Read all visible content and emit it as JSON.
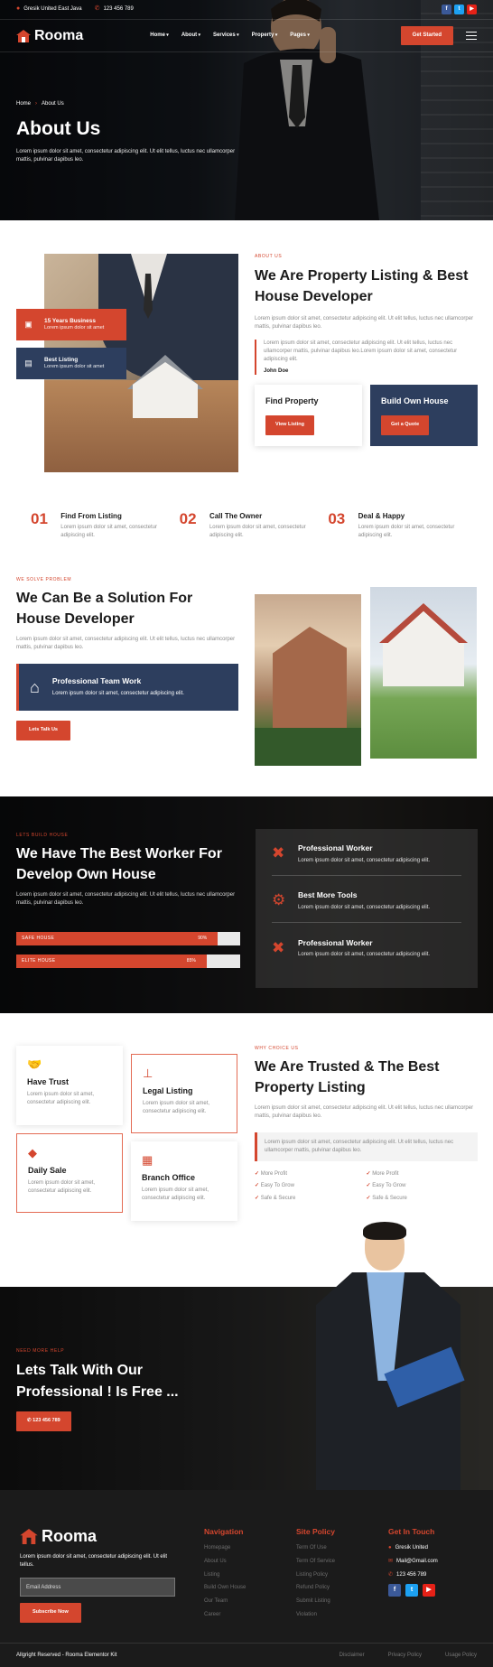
{
  "topbar": {
    "address": "Gresik United East Java",
    "phone": "123 456 789"
  },
  "brand": {
    "name": "Rooma"
  },
  "nav": {
    "items": [
      "Home",
      "About",
      "Services",
      "Property",
      "Pages"
    ],
    "cta": "Get Started"
  },
  "hero": {
    "crumb_home": "Home",
    "crumb_current": "About Us",
    "title": "About Us",
    "desc": "Lorem ipsum dolor sit amet, consectetur adipiscing elit. Ut elit tellus, luctus nec ullamcorper mattis, pulvinar dapibus leo."
  },
  "about": {
    "badges": [
      {
        "title": "15 Years Business",
        "text": "Lorem ipsum dolor sit amet"
      },
      {
        "title": "Best Listing",
        "text": "Lorem ipsum dolor sit amet"
      }
    ],
    "eyebrow": "About Us",
    "title": "We Are Property Listing & Best House Developer",
    "desc": "Lorem ipsum dolor sit amet, consectetur adipiscing elit. Ut elit tellus, luctus nec ullamcorper mattis, pulvinar dapibus leo.",
    "quote": "Lorem ipsum dolor sit amet, consectetur adipiscing elit. Ut elit tellus, luctus nec ullamcorper mattis, pulvinar dapibus leo.Lorem ipsum dolor sit amet, consectetur adipiscing elit.",
    "author": "John Doe",
    "card1": {
      "title": "Find Property",
      "button": "View Listing"
    },
    "card2": {
      "title": "Build Own House",
      "button": "Get a Quote"
    }
  },
  "steps": [
    {
      "num": "01",
      "title": "Find From Listing",
      "text": "Lorem ipsum dolor sit amet, consectetur adipiscing elit."
    },
    {
      "num": "02",
      "title": "Call The Owner",
      "text": "Lorem ipsum dolor sit amet, consectetur adipiscing elit."
    },
    {
      "num": "03",
      "title": "Deal & Happy",
      "text": "Lorem ipsum dolor sit amet, consectetur adipiscing elit."
    }
  ],
  "solution": {
    "eyebrow": "We Solve Problem",
    "title": "We Can Be a Solution For House Developer",
    "desc": "Lorem ipsum dolor sit amet, consectetur adipiscing elit. Ut elit tellus, luctus nec ullamcorper mattis, pulvinar dapibus leo.",
    "team_title": "Professional Team Work",
    "team_text": "Lorem ipsum dolor sit amet, consectetur adipiscing elit.",
    "button": "Lets Talk Us"
  },
  "worker": {
    "eyebrow": "Lets Build House",
    "title": "We Have The Best Worker For Develop Own House",
    "desc": "Lorem ipsum dolor sit amet, consectetur adipiscing elit. Ut elit tellus, luctus nec ullamcorper mattis, pulvinar dapibus leo.",
    "bars": [
      {
        "label": "SAFE HOUSE",
        "pct": "90%",
        "value": 0.9
      },
      {
        "label": "ELITE HOUSE",
        "pct": "85%",
        "value": 0.85
      }
    ],
    "items": [
      {
        "title": "Professional Worker",
        "text": "Lorem ipsum dolor sit amet, consectetur adipiscing elit."
      },
      {
        "title": "Best More Tools",
        "text": "Lorem ipsum dolor sit amet, consectetur adipiscing elit."
      },
      {
        "title": "Professional Worker",
        "text": "Lorem ipsum dolor sit amet, consectetur adipiscing elit."
      }
    ]
  },
  "trust": {
    "cards": [
      {
        "title": "Have Trust",
        "text": "Lorem ipsum dolor sit amet, consectetur adipiscing elit."
      },
      {
        "title": "Legal Listing",
        "text": "Lorem ipsum dolor sit amet, consectetur adipiscing elit."
      },
      {
        "title": "Daily Sale",
        "text": "Lorem ipsum dolor sit amet, consectetur adipiscing elit."
      },
      {
        "title": "Branch Office",
        "text": "Lorem ipsum dolor sit amet, consectetur adipiscing elit."
      }
    ],
    "eyebrow": "Why Choice Us",
    "title": "We Are Trusted & The Best Property Listing",
    "desc": "Lorem ipsum dolor sit amet, consectetur adipiscing elit. Ut elit tellus, luctus nec ullamcorper mattis, pulvinar dapibus leo.",
    "quote": "Lorem ipsum dolor sit amet, consectetur adipiscing elit. Ut elit tellus, luctus nec ullamcorper mattis, pulvinar dapibus leo.",
    "checks": [
      "More Profit",
      "More Profit",
      "Easy To Grow",
      "Easy To Grow",
      "Safe & Secure",
      "Safe & Secure"
    ]
  },
  "cta": {
    "eyebrow": "Need More Help",
    "title": "Lets Talk With Our Professional ! Is Free ...",
    "phone": "123 456 789"
  },
  "footer": {
    "desc": "Lorem ipsum dolor sit amet, consectetur adipiscing elit. Ut elit tellus.",
    "email_placeholder": "Email Address",
    "subscribe": "Subscribe Now",
    "nav_title": "Navigation",
    "nav": [
      "Homepage",
      "About Us",
      "Listing",
      "Build Own House",
      "Our Team",
      "Career"
    ],
    "policy_title": "Site Policy",
    "policy": [
      "Term Of Use",
      "Term Of Service",
      "Listing Policy",
      "Refund Policy",
      "Submit Listing",
      "Violation"
    ],
    "touch_title": "Get In Touch",
    "address": "Gresik United",
    "mail": "Mail@Gmail.com",
    "phone": "123 456 789",
    "copyright": "Allgright Reserved - Rooma Elementor Kit",
    "bottom_links": [
      "Disclaimer",
      "Privacy Policy",
      "Usage Policy"
    ]
  },
  "colors": {
    "accent": "#d4462e",
    "navy": "#2d3e5e",
    "dark": "#1b1b1b",
    "facebook": "#3b5998",
    "twitter": "#1da1f2",
    "youtube": "#e62117"
  }
}
